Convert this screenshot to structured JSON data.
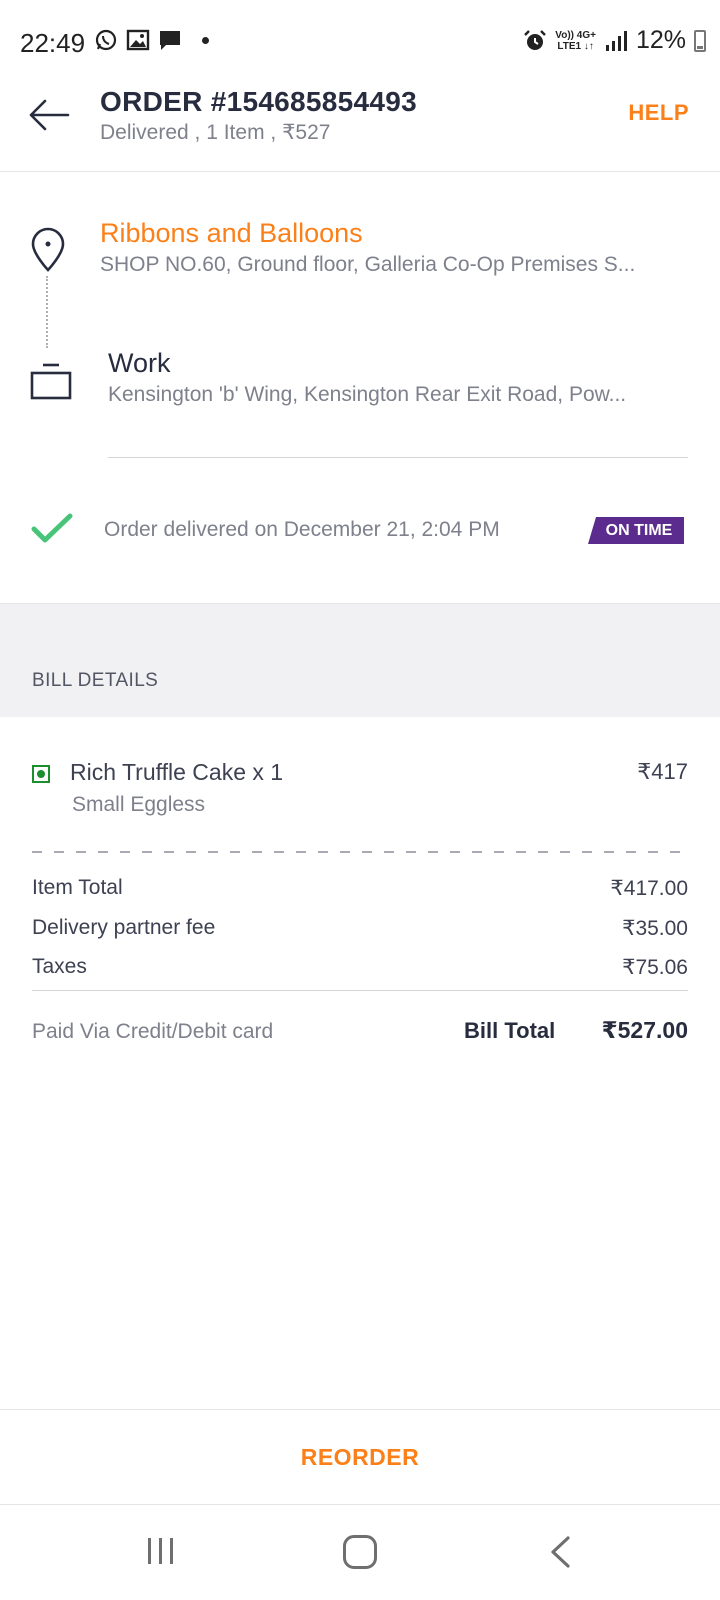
{
  "status_bar": {
    "time": "22:49",
    "network_top": "Vo)) 4G+",
    "network_bottom": "LTE1 ↓↑",
    "battery": "12%"
  },
  "header": {
    "order_title": "ORDER #154685854493",
    "order_subtitle": "Delivered , 1 Item , ₹527",
    "help_label": "HELP"
  },
  "restaurant": {
    "name": "Ribbons and Balloons",
    "address": "SHOP NO.60, Ground floor, Galleria Co-Op Premises S..."
  },
  "delivery_address": {
    "label": "Work",
    "address": "Kensington 'b' Wing, Kensington Rear Exit Road, Pow..."
  },
  "delivery_status": {
    "text": "Order delivered on December 21, 2:04 PM",
    "badge": "ON TIME",
    "badge_color": "#5b2c8e"
  },
  "bill": {
    "title": "BILL DETAILS",
    "item": {
      "name": "Rich Truffle Cake x 1",
      "variant": "Small Eggless",
      "price": "₹417"
    },
    "charges": [
      {
        "label": "Item Total",
        "value": "₹417.00"
      },
      {
        "label": "Delivery partner fee",
        "value": "₹35.00"
      },
      {
        "label": "Taxes",
        "value": "₹75.06"
      }
    ],
    "paid_via": "Paid Via Credit/Debit card",
    "total_label": "Bill Total",
    "total_value": "₹527.00"
  },
  "reorder_label": "REORDER",
  "colors": {
    "accent": "#fc8019",
    "veg": "#1a8f2d",
    "check": "#48c479"
  }
}
